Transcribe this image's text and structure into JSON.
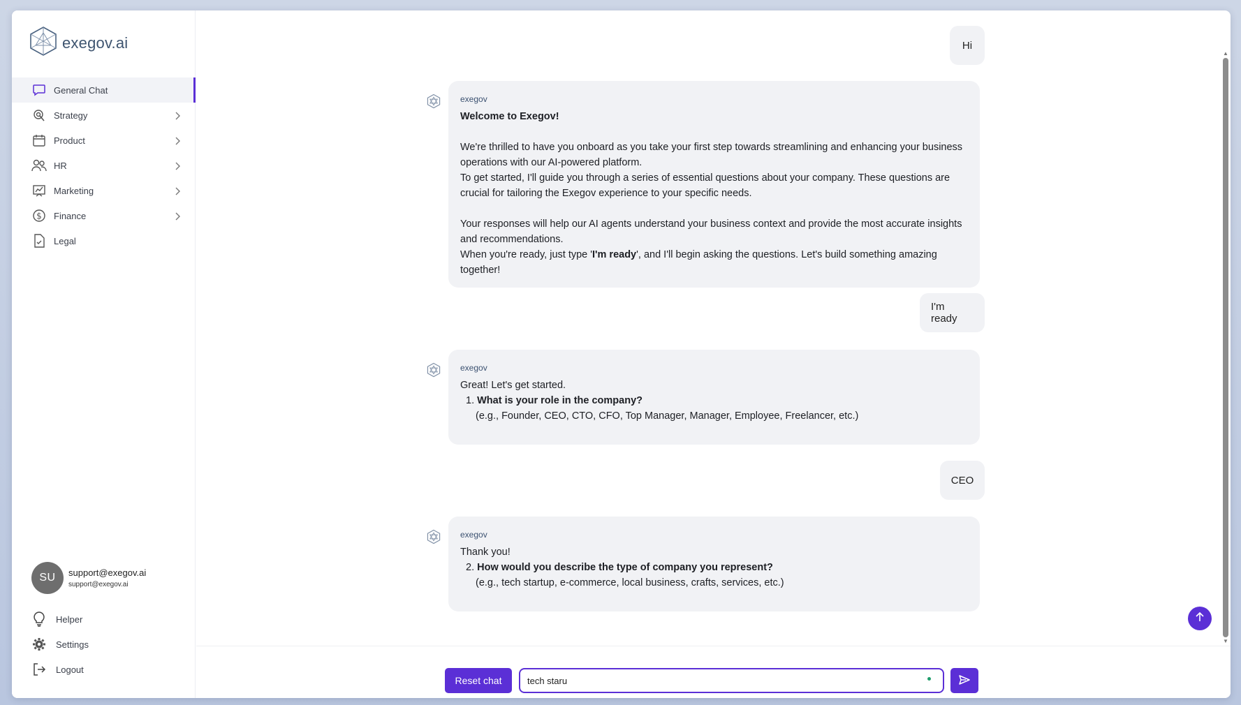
{
  "app": {
    "logo_text": "exegov.ai"
  },
  "sidebar": {
    "items": [
      {
        "label": "General Chat",
        "icon": "chat-bubble-icon",
        "active": true
      },
      {
        "label": "Strategy",
        "icon": "strategy-icon"
      },
      {
        "label": "Product",
        "icon": "calendar-icon"
      },
      {
        "label": "HR",
        "icon": "people-icon"
      },
      {
        "label": "Marketing",
        "icon": "chart-board-icon"
      },
      {
        "label": "Finance",
        "icon": "dollar-circle-icon"
      },
      {
        "label": "Legal",
        "icon": "document-check-icon"
      }
    ],
    "user": {
      "initials": "SU",
      "name": "support@exegov.ai",
      "email": "support@exegov.ai"
    },
    "bottom": [
      {
        "label": "Helper",
        "icon": "lightbulb-icon"
      },
      {
        "label": "Settings",
        "icon": "gear-icon"
      },
      {
        "label": "Logout",
        "icon": "logout-icon"
      }
    ]
  },
  "chat": {
    "user_msgs": [
      "Hi",
      "I'm ready",
      "CEO"
    ],
    "bot_name": "exegov",
    "bot1": {
      "title": "Welcome to Exegov!",
      "p1": "We're thrilled to have you onboard as you take your first step towards streamlining and enhancing your business operations with our AI-powered platform.",
      "p2": "To get started, I'll guide you through a series of essential questions about your company. These questions are crucial for tailoring the Exegov experience to your specific needs.",
      "p3": "Your responses will help our AI agents understand your business context and provide the most accurate insights and recommendations.",
      "p4_before": "When you're ready, just type '",
      "p4_bold": "I'm ready",
      "p4_after": "', and I'll begin asking the questions. Let's build something amazing together!"
    },
    "bot2": {
      "intro": "Great! Let's get started.",
      "q_num": "1.",
      "q": "What is your role in the company?",
      "hint": "(e.g., Founder, CEO, CTO, CFO, Top Manager, Manager, Employee, Freelancer, etc.)"
    },
    "bot3": {
      "intro": "Thank you!",
      "q_num": "2.",
      "q": "How would you describe the type of company you represent?",
      "hint": "(e.g., tech startup, e-commerce, local business, crafts, services, etc.)"
    }
  },
  "composer": {
    "reset_label": "Reset chat",
    "input_value": "tech staru"
  },
  "colors": {
    "accent": "#5b2fd6",
    "bubble": "#f1f2f5"
  }
}
